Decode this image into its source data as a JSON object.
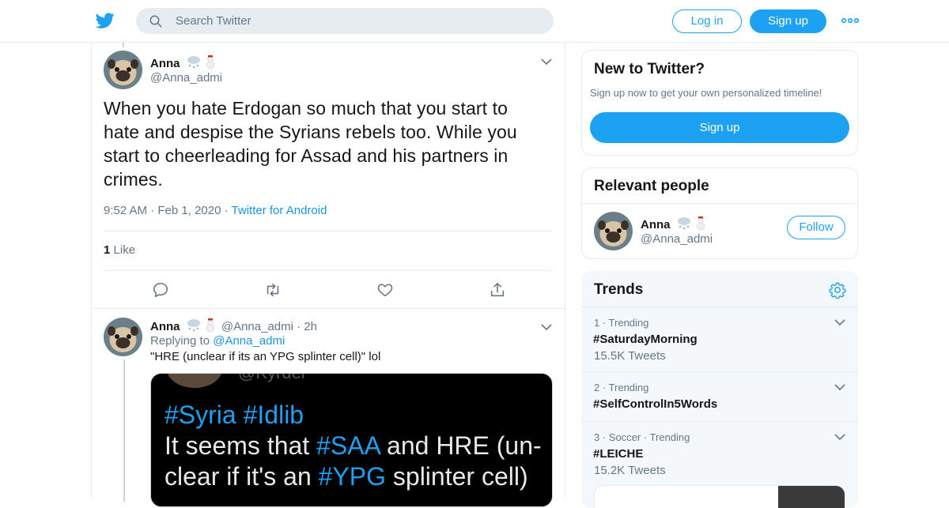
{
  "header": {
    "search_placeholder": "Search Twitter",
    "login_label": "Log in",
    "signup_label": "Sign up",
    "brand_color": "#1da1f2"
  },
  "main_tweet": {
    "author_name": "Anna",
    "author_handle": "@Anna_admi",
    "text": "When you hate Erdogan so much that you start to hate and despise the Syrians rebels too. While you start to cheerleading for Assad and his partners in crimes.",
    "time": "9:52 AM",
    "date": "Feb 1, 2020",
    "source": "Twitter for Android",
    "like_count": "1",
    "like_label": "Like"
  },
  "reply_tweet": {
    "author_name": "Anna",
    "author_handle": "@Anna_admi",
    "age": "2h",
    "replying_prefix": "Replying to",
    "replying_to": "@Anna_admi",
    "text": "\"HRE (unclear if its an YPG splinter cell)\" lol",
    "media": {
      "faded_handle": "@Kyrdel",
      "line1_tag1": "#Syria",
      "line1_tag2": "#Idlib",
      "line2_pre": "It seems that ",
      "line2_tag": "#SAA",
      "line2_post": " and HRE (un-",
      "line3_pre": "clear if it's an ",
      "line3_tag": "#YPG",
      "line3_post": " splinter cell)"
    }
  },
  "new_to_twitter": {
    "title": "New to Twitter?",
    "description": "Sign up now to get your own personalized timeline!",
    "signup_label": "Sign up"
  },
  "relevant_people": {
    "title": "Relevant people",
    "name": "Anna",
    "handle": "@Anna_admi",
    "follow_label": "Follow"
  },
  "trends": {
    "title": "Trends",
    "items": [
      {
        "context": "1 · Trending",
        "name": "#SaturdayMorning",
        "count": "15.5K Tweets"
      },
      {
        "context": "2 · Trending",
        "name": "#SelfControlIn5Words",
        "count": ""
      },
      {
        "context": "3 · Soccer · Trending",
        "name": "#LEICHE",
        "count": "15.2K Tweets"
      }
    ]
  }
}
